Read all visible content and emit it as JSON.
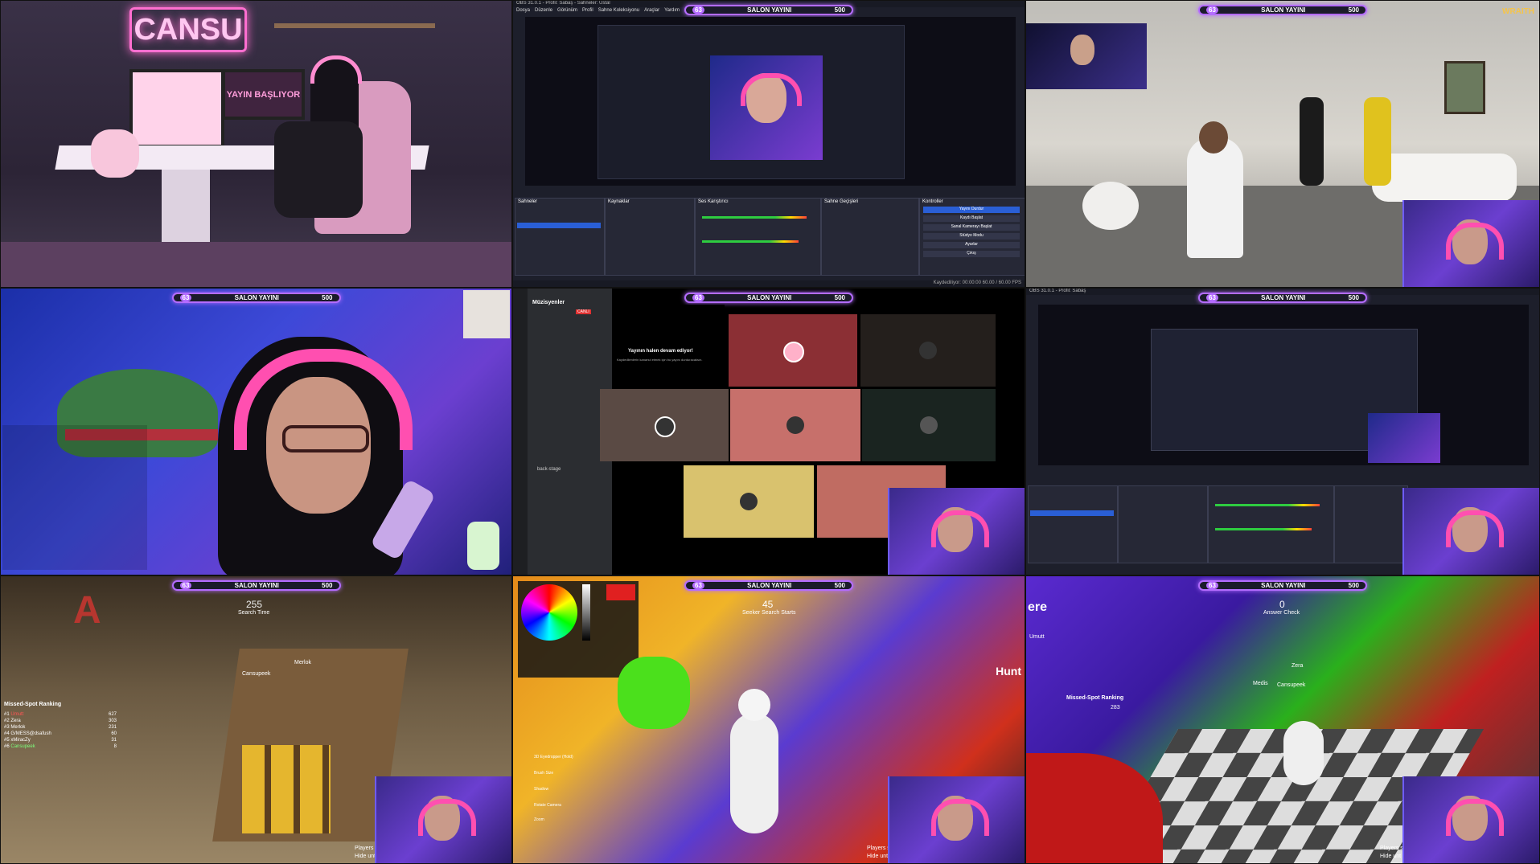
{
  "stream_title": {
    "text": "SALON YAYINI",
    "left_num": "63",
    "right_num": "500"
  },
  "cell1": {
    "sign": "CANSU",
    "screen_text": "YAYIN BAŞLIYOR"
  },
  "cell2": {
    "window_title": "OBS 31.0.1 - Profil: Sabaş - Sahneler: Ustal",
    "menu": [
      "Dosya",
      "Düzenle",
      "Görünüm",
      "Profil",
      "Sahne Koleksiyonu",
      "Araçlar",
      "Yardım"
    ],
    "panels": [
      "Sahneler",
      "Kaynaklar",
      "Ses Karıştırıcı",
      "Sahne Geçişleri",
      "Kontroller"
    ],
    "controls": [
      "Yayını Durdur",
      "Kaydı Başlat",
      "Sanal Kamerayı Başlat",
      "Stüdyo Modu",
      "Ayarlar",
      "Çıkış"
    ],
    "statusbar": "Kaydediliyor: 00:00:00  60.00 / 60.00 FPS"
  },
  "cell3": {
    "brand": "WRAITH"
  },
  "cell5": {
    "server": "Müzisyenler",
    "channel_msg": "Yayının halen devam ediyor!",
    "channel_sub": "Kaydedilenlerin kanarsıl etmek için bu yayını durduracaksın.",
    "live": "CANLI",
    "section": "back-stage"
  },
  "cell6": {
    "window_title": "OBS 31.0.1 - Profil: Sabaş"
  },
  "cell7": {
    "timer": "255",
    "timer_label": "Search Time",
    "ranking_title": "Missed-Spot Ranking",
    "ranking": [
      [
        "#1",
        "Umutt",
        "627"
      ],
      [
        "#2",
        "Zera",
        "303"
      ],
      [
        "#3",
        "Merlok",
        "231"
      ],
      [
        "#4",
        "G/MESS@dsafush",
        "60"
      ],
      [
        "#5",
        "xMiracZy",
        "31"
      ],
      [
        "#6",
        "Cansupeek",
        "8"
      ]
    ],
    "player_tag": "Cansupeek",
    "player_tag2": "Merlok",
    "bottom": "Players s",
    "bottom2": "Hide unt"
  },
  "cell8": {
    "timer": "45",
    "timer_label": "Seeker Search Starts",
    "hunt": "Hunt",
    "bottom": "Players s",
    "bottom2": "Hide unt",
    "tool": "3D Eyedropper (Hold)",
    "tool2": "Brush Size",
    "tool3": "Shadow",
    "tool4": "Rotate Camera",
    "tool5": "Zoom"
  },
  "cell9": {
    "timer": "0",
    "timer_label": "Answer Check",
    "edge_text": "ere",
    "ranking_title": "Missed-Spot Ranking",
    "tags": [
      "Zera",
      "Medis",
      "Cansupeek",
      "Umutt"
    ],
    "score": "283",
    "bottom": "Players s",
    "bottom2": "Hide unt"
  }
}
